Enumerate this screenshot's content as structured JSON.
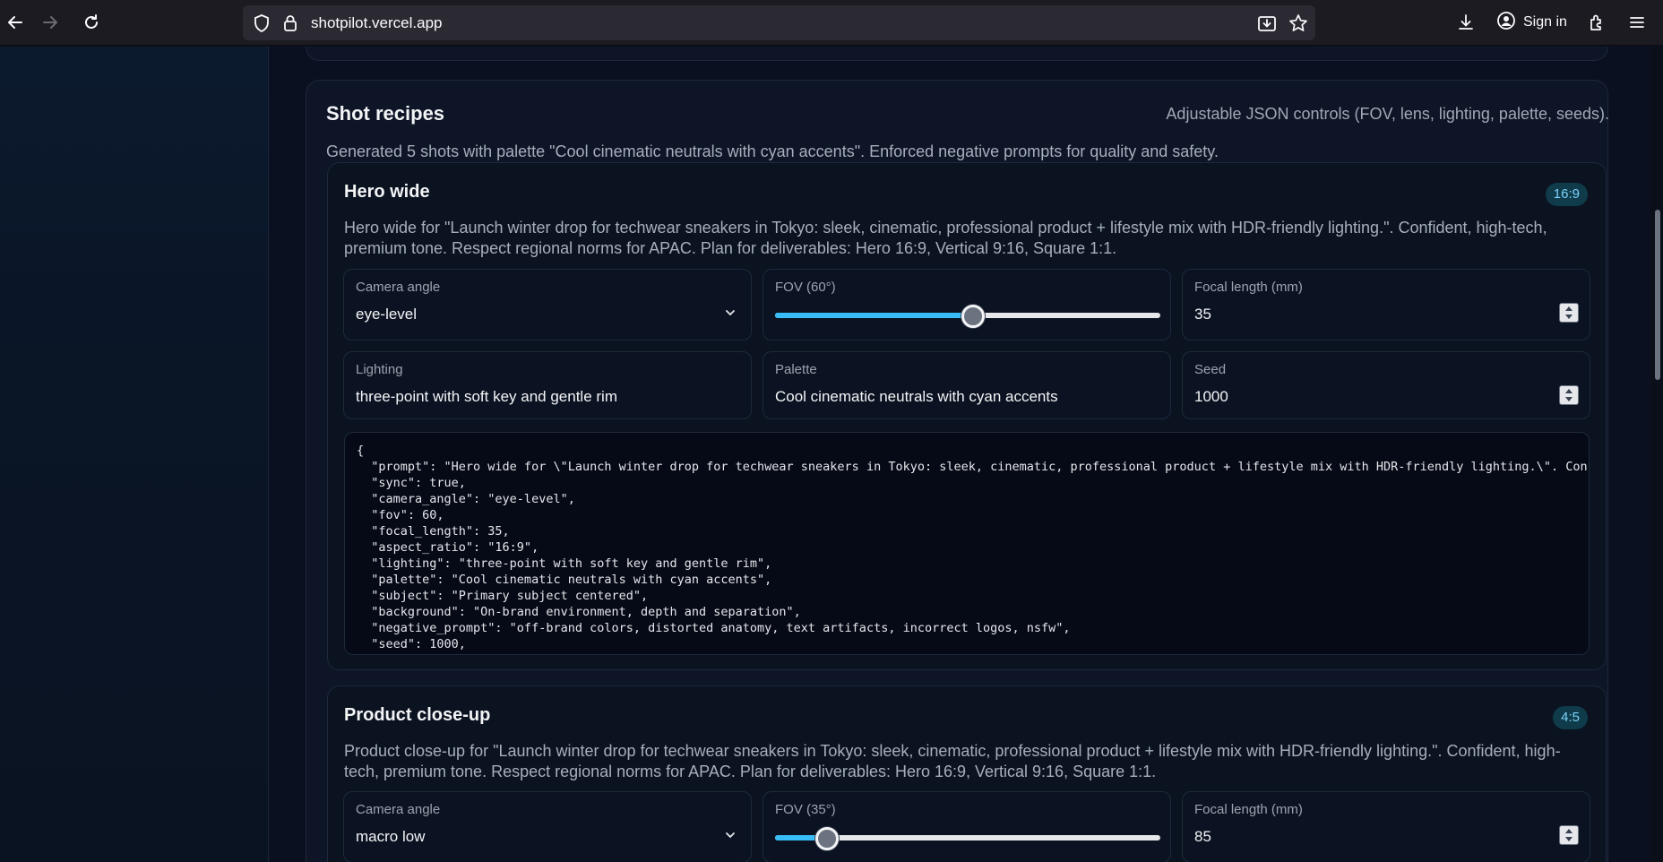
{
  "browser": {
    "url": "shotpilot.vercel.app",
    "sign_in_label": "Sign in"
  },
  "panel": {
    "title": "Shot recipes",
    "subtitle": "Adjustable JSON controls (FOV, lens, lighting, palette, seeds).",
    "description": "Generated 5 shots with palette \"Cool cinematic neutrals with cyan accents\". Enforced negative prompts for quality and safety."
  },
  "shots": [
    {
      "title": "Hero wide",
      "aspect_ratio": "16:9",
      "description": "Hero wide for \"Launch winter drop for techwear sneakers in Tokyo: sleek, cinematic, professional product + lifestyle mix with HDR-friendly lighting.\". Confident, high-tech, premium tone. Respect regional norms for APAC. Plan for deliverables: Hero 16:9, Vertical 9:16, Square 1:1.",
      "camera_angle_label": "Camera angle",
      "camera_angle": "eye-level",
      "fov_label": "FOV (60°)",
      "fov_fraction": 0.515,
      "focal_label": "Focal length (mm)",
      "focal_length": "35",
      "lighting_label": "Lighting",
      "lighting": "three-point with soft key and gentle rim",
      "palette_label": "Palette",
      "palette": "Cool cinematic neutrals with cyan accents",
      "seed_label": "Seed",
      "seed": "1000",
      "json_text": "{\n  \"prompt\": \"Hero wide for \\\"Launch winter drop for techwear sneakers in Tokyo: sleek, cinematic, professional product + lifestyle mix with HDR-friendly lighting.\\\". Confident, high-tech, premium tone.\",\n  \"sync\": true,\n  \"camera_angle\": \"eye-level\",\n  \"fov\": 60,\n  \"focal_length\": 35,\n  \"aspect_ratio\": \"16:9\",\n  \"lighting\": \"three-point with soft key and gentle rim\",\n  \"palette\": \"Cool cinematic neutrals with cyan accents\",\n  \"subject\": \"Primary subject centered\",\n  \"background\": \"On-brand environment, depth and separation\",\n  \"negative_prompt\": \"off-brand colors, distorted anatomy, text artifacts, incorrect logos, nsfw\",\n  \"seed\": 1000,"
    },
    {
      "title": "Product close-up",
      "aspect_ratio": "4:5",
      "description": "Product close-up for \"Launch winter drop for techwear sneakers in Tokyo: sleek, cinematic, professional product + lifestyle mix with HDR-friendly lighting.\". Confident, high-tech, premium tone. Respect regional norms for APAC. Plan for deliverables: Hero 16:9, Vertical 9:16, Square 1:1.",
      "camera_angle_label": "Camera angle",
      "camera_angle": "macro low",
      "fov_label": "FOV (35°)",
      "fov_fraction": 0.135,
      "focal_label": "Focal length (mm)",
      "focal_length": "85"
    }
  ]
}
